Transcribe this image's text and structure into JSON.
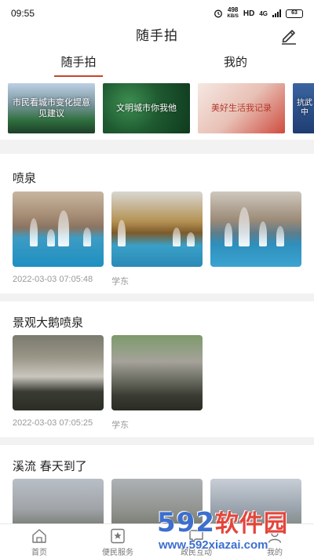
{
  "status": {
    "time": "09:55",
    "speed_value": "498",
    "speed_unit": "KB/S",
    "hd": "HD",
    "network": "4G",
    "battery": "63"
  },
  "header": {
    "title": "随手拍",
    "edit_icon": "pencil-edit-icon"
  },
  "tabs": [
    {
      "label": "随手拍",
      "active": true
    },
    {
      "label": "我的",
      "active": false
    }
  ],
  "topics": [
    {
      "label": "市民看城市变化提意见建议"
    },
    {
      "label": "文明城市你我他"
    },
    {
      "label": "美好生活我记录"
    },
    {
      "label": "抗武中"
    }
  ],
  "posts": [
    {
      "title": "喷泉",
      "date": "2022-03-03 07:05:48",
      "author": "学东",
      "photo_count": 3
    },
    {
      "title": "景观大鹅喷泉",
      "date": "2022-03-03 07:05:25",
      "author": "学东",
      "photo_count": 2
    },
    {
      "title": "溪流  春天到了",
      "photo_count": 3
    }
  ],
  "bottom_nav": [
    {
      "label": "首页",
      "icon": "home-icon"
    },
    {
      "label": "便民服务",
      "icon": "star-bookmark-icon"
    },
    {
      "label": "政民互动",
      "icon": "chat-icon"
    },
    {
      "label": "我的",
      "icon": "user-icon"
    }
  ],
  "watermark": {
    "logo_digits": "592",
    "logo_text": "软件园",
    "url": "www.592xiazai.com"
  },
  "colors": {
    "accent": "#c4462b",
    "meta_text": "#999999",
    "watermark_blue": "#3d6fcf",
    "watermark_red": "#e4453b"
  }
}
